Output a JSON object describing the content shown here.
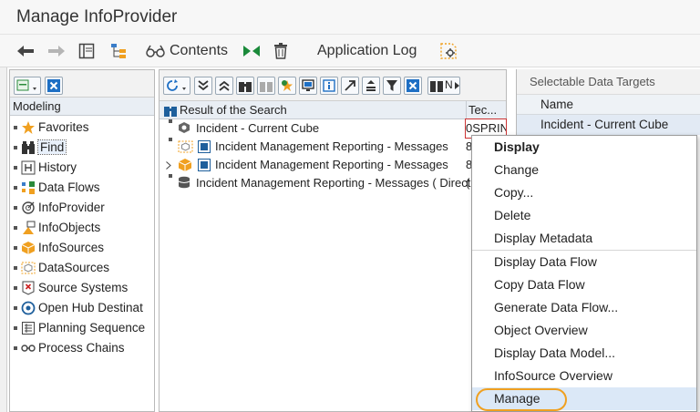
{
  "window": {
    "title": "Manage InfoProvider"
  },
  "toolbar": {
    "contents_label": "Contents",
    "application_log_label": "Application Log"
  },
  "modeling": {
    "header": "Modeling",
    "items": [
      {
        "label": "Favorites",
        "icon": "star-icon"
      },
      {
        "label": "Find",
        "icon": "binoculars-icon"
      },
      {
        "label": "History",
        "icon": "history-icon"
      },
      {
        "label": "Data Flows",
        "icon": "data-flow-icon"
      },
      {
        "label": "InfoProvider",
        "icon": "infoprovider-icon"
      },
      {
        "label": "InfoObjects",
        "icon": "infoobjects-icon"
      },
      {
        "label": "InfoSources",
        "icon": "infosource-icon"
      },
      {
        "label": "DataSources",
        "icon": "datasource-icon"
      },
      {
        "label": "Source Systems",
        "icon": "source-system-icon"
      },
      {
        "label": "Open Hub Destinat",
        "icon": "open-hub-icon"
      },
      {
        "label": "Planning Sequence",
        "icon": "planning-sequence-icon"
      },
      {
        "label": "Process Chains",
        "icon": "process-chain-icon"
      }
    ]
  },
  "search": {
    "toolbar_text": "N",
    "column_result": "Result of the Search",
    "column_tech": "Tec...",
    "rows": [
      {
        "name": "Incident - Current Cube",
        "tech": "0SPRIN"
      },
      {
        "name": "Incident Management Reporting - Messages",
        "tech": "8"
      },
      {
        "name": "Incident Management Reporting - Messages",
        "tech": "8"
      },
      {
        "name": "Incident Management Reporting - Messages ( Direct",
        "tech": "("
      }
    ]
  },
  "targets": {
    "title": "Selectable Data Targets",
    "column_name": "Name",
    "rows": [
      "Incident - Current Cube"
    ]
  },
  "context_menu": {
    "items": [
      "Display",
      "Change",
      "Copy...",
      "Delete",
      "Display Metadata",
      "Display Data Flow",
      "Copy Data Flow",
      "Generate Data Flow...",
      "Object Overview",
      "Display Data Model...",
      "InfoSource Overview",
      "Manage"
    ],
    "highlight_color": "#f0a020"
  }
}
